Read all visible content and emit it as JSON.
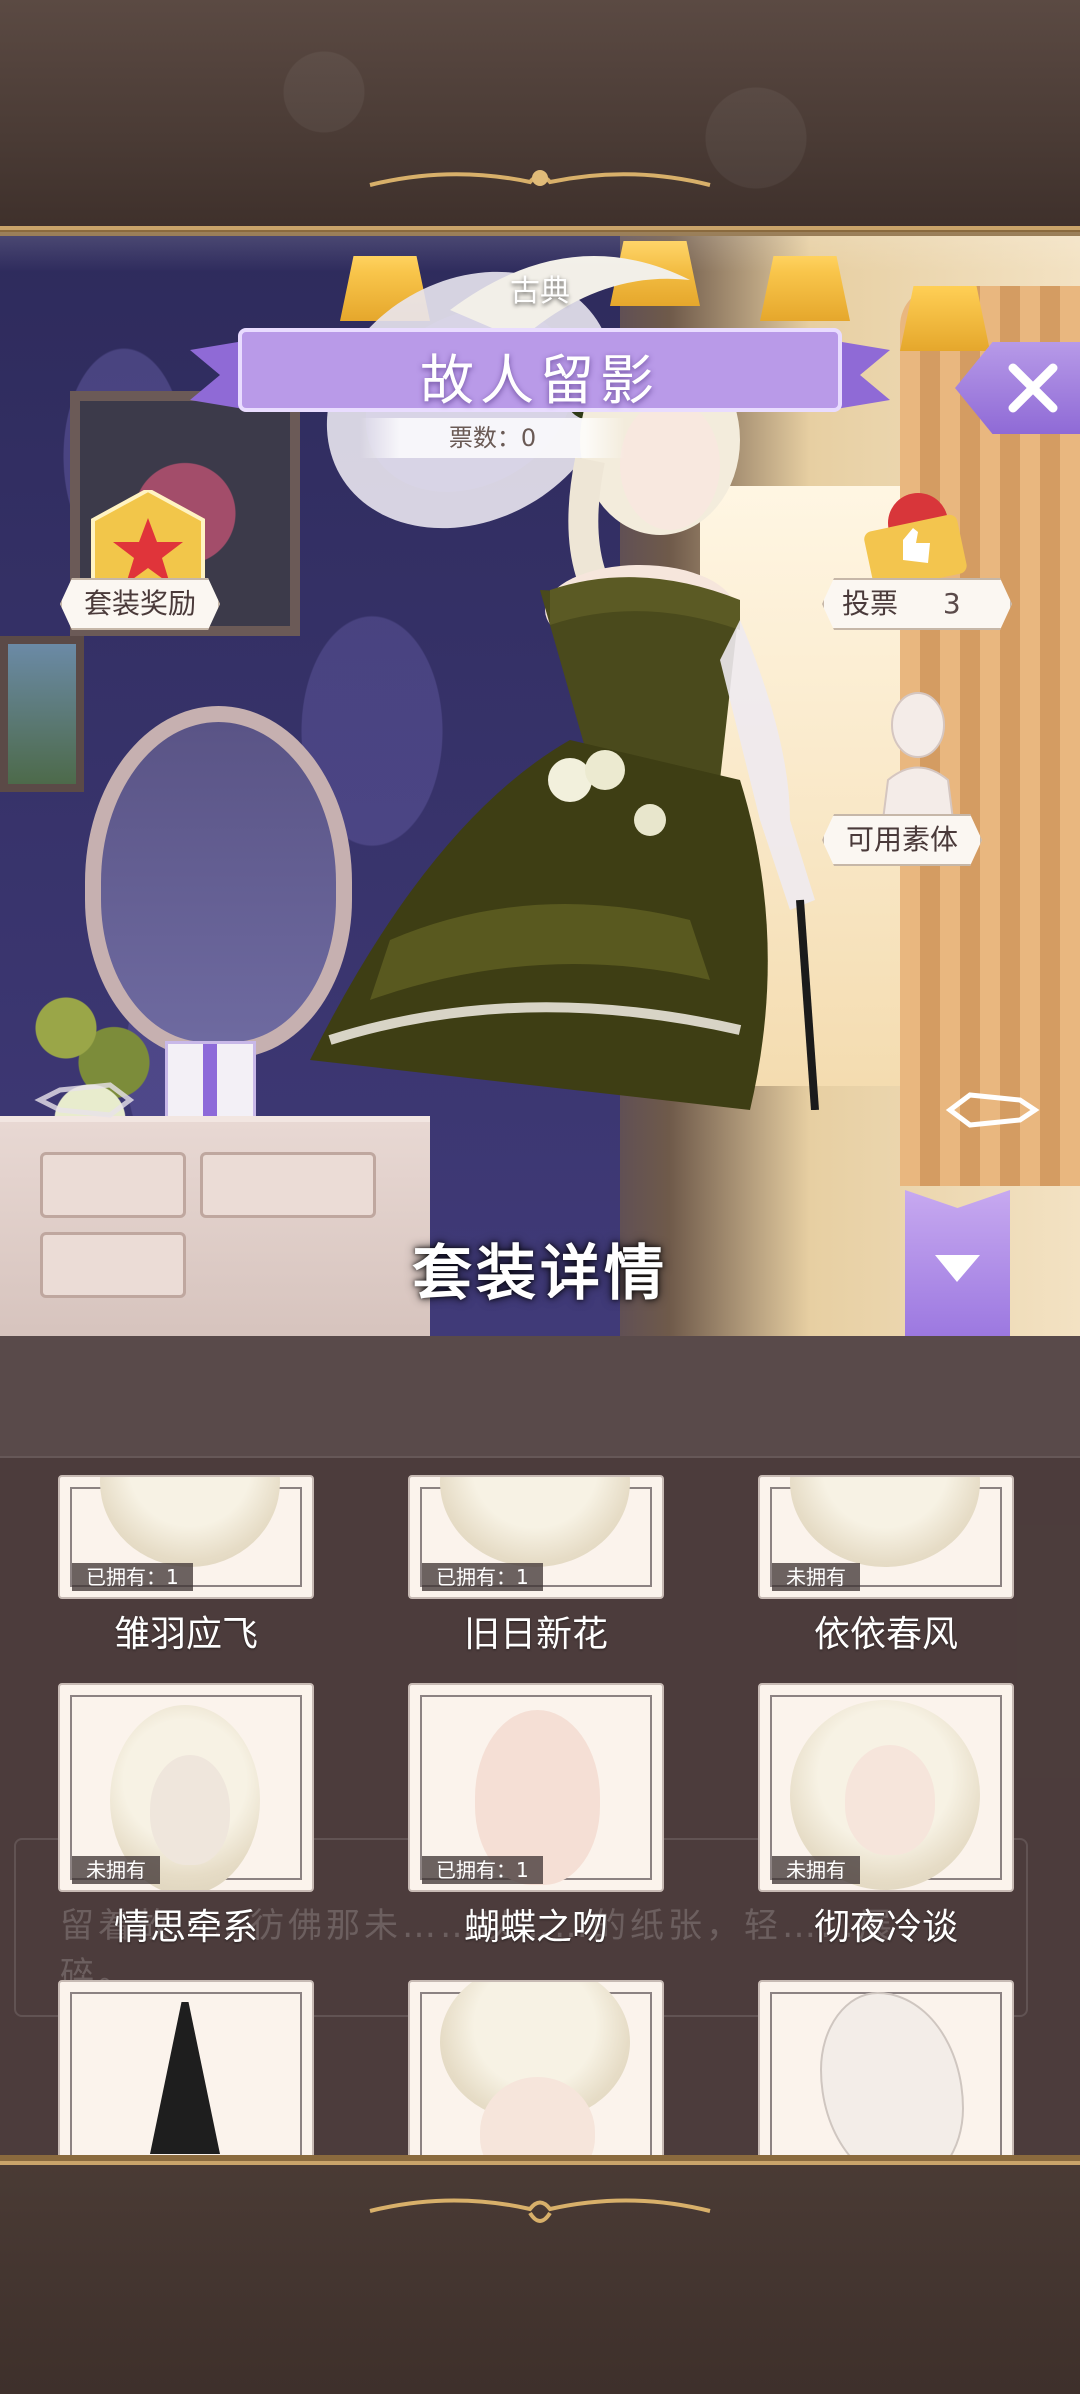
{
  "category_label": "古典",
  "suit_title": "故人留影",
  "votes_label": "票数：0",
  "suit_reward_label": "套装奖励",
  "vote_button": {
    "label": "投票",
    "count": "3"
  },
  "available_material_label": "可用素体",
  "detail_title": "套装详情",
  "description_text": "留着故……彷佛那未……以……的纸张，轻……展碎。",
  "items": [
    {
      "name": "雏羽应飞",
      "status": "已拥有：1"
    },
    {
      "name": "旧日新花",
      "status": "已拥有：1"
    },
    {
      "name": "依依春风",
      "status": "未拥有"
    },
    {
      "name": "情思牵系",
      "status": "未拥有"
    },
    {
      "name": "蝴蝶之吻",
      "status": "已拥有：1"
    },
    {
      "name": "彻夜冷谈",
      "status": "未拥有"
    },
    {
      "name": "",
      "status": ""
    },
    {
      "name": "",
      "status": ""
    },
    {
      "name": "",
      "status": ""
    }
  ],
  "colors": {
    "accent_purple": "#9b77e0",
    "frame_gold": "#c9a46a",
    "panel_bg": "#4e3e3e"
  }
}
